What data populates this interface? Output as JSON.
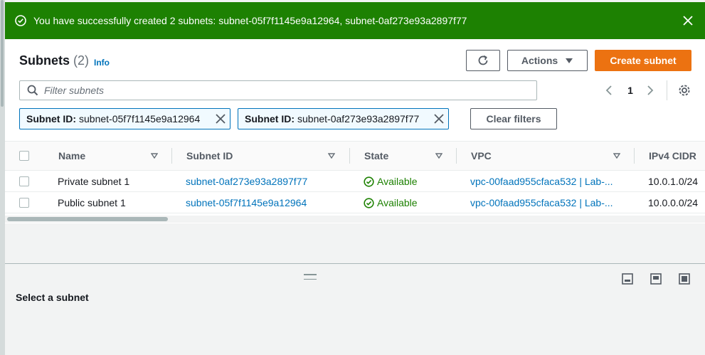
{
  "colors": {
    "success": "#1d8102",
    "link": "#0073bb",
    "primary": "#ec7211"
  },
  "flash": {
    "message": "You have successfully created 2 subnets: subnet-05f7f1145e9a12964, subnet-0af273e93a2897f77",
    "icon": "check-circle-icon",
    "close_icon": "close-icon"
  },
  "header": {
    "title": "Subnets",
    "count": "(2)",
    "info": "Info",
    "actions_label": "Actions",
    "create_label": "Create subnet"
  },
  "filter": {
    "placeholder": "Filter subnets"
  },
  "pagination": {
    "page": "1"
  },
  "tokens": [
    {
      "key": "Subnet ID:",
      "value": "subnet-05f7f1145e9a12964"
    },
    {
      "key": "Subnet ID:",
      "value": "subnet-0af273e93a2897f77"
    }
  ],
  "clear_filters": "Clear filters",
  "table": {
    "columns": [
      "Name",
      "Subnet ID",
      "State",
      "VPC",
      "IPv4 CIDR"
    ],
    "rows": [
      {
        "name": "Private subnet 1",
        "subnet_id": "subnet-0af273e93a2897f77",
        "state": "Available",
        "vpc": "vpc-00faad955cfaca532 | Lab-...",
        "cidr": "10.0.1.0/24"
      },
      {
        "name": "Public subnet 1",
        "subnet_id": "subnet-05f7f1145e9a12964",
        "state": "Available",
        "vpc": "vpc-00faad955cfaca532 | Lab-...",
        "cidr": "10.0.0.0/24"
      }
    ]
  },
  "details": {
    "message": "Select a subnet"
  }
}
